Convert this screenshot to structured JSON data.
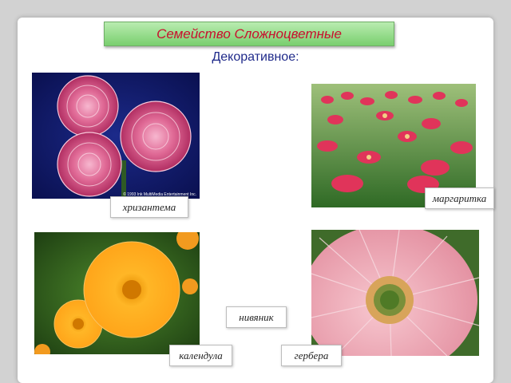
{
  "slide": {
    "title": "Семейство Сложноцветные",
    "subtitle": "Декоративное:"
  },
  "flowers": {
    "chrysanthemum": {
      "label": "хризантема",
      "image": "chrysanthemum-photo",
      "caption": "© 1993 Ink MultiMedia Entertainment Inc."
    },
    "daisy": {
      "label": "маргаритка",
      "image": "daisy-photo"
    },
    "calendula": {
      "label": "календула",
      "image": "calendula-photo"
    },
    "gerbera": {
      "label": "гербера",
      "image": "gerbera-photo"
    },
    "oxeye": {
      "label": "нивяник"
    }
  },
  "colors": {
    "title_text": "#c8102e",
    "title_bg": "#79cf6e",
    "subtitle_text": "#1f2a8a"
  }
}
